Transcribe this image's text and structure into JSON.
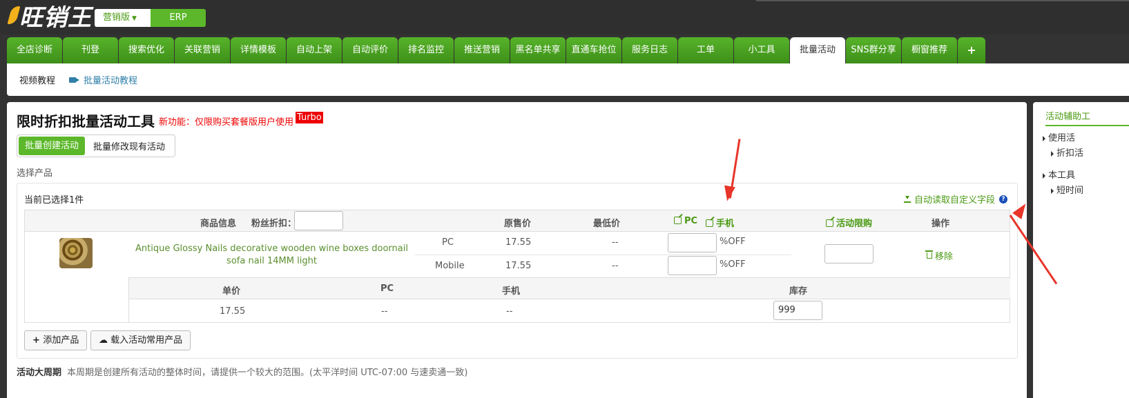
{
  "brand": {
    "logo_text": "旺销王",
    "version_label": "营销版",
    "erp_label": "ERP"
  },
  "tabs": [
    {
      "label": "全店诊断",
      "active": false
    },
    {
      "label": "刊登",
      "active": false
    },
    {
      "label": "搜索优化",
      "active": false
    },
    {
      "label": "关联营销",
      "active": false
    },
    {
      "label": "详情模板",
      "active": false
    },
    {
      "label": "自动上架",
      "active": false
    },
    {
      "label": "自动评价",
      "active": false
    },
    {
      "label": "排名监控",
      "active": false
    },
    {
      "label": "推送营销",
      "active": false
    },
    {
      "label": "黑名单共享",
      "active": false
    },
    {
      "label": "直通车抢位",
      "active": false
    },
    {
      "label": "服务日志",
      "active": false
    },
    {
      "label": "工单",
      "active": false
    },
    {
      "label": "小工具",
      "active": false
    },
    {
      "label": "批量活动",
      "active": true
    },
    {
      "label": "SNS群分享",
      "active": false
    },
    {
      "label": "橱窗推荐",
      "active": false
    },
    {
      "label": "+",
      "active": false
    }
  ],
  "subnav": {
    "video_label": "视频教程",
    "tutorial_link": "批量活动教程"
  },
  "main": {
    "title": "限时折扣批量活动工具",
    "new_feature": "新功能：仅限购买套餐版用户使用",
    "turbo": "Turbo",
    "btn_create": "批量创建活动",
    "btn_modify": "批量修改现有活动",
    "section_label": "选择产品",
    "selected_count": "当前已选择1件",
    "auto_read": "自动读取自定义字段",
    "help": "?",
    "headers": {
      "product_info": "商品信息",
      "fans_discount": "粉丝折扣：",
      "original_price": "原售价",
      "lowest_price": "最低价",
      "pc": "PC",
      "mobile": "手机",
      "limit": "活动限购",
      "action": "操作"
    },
    "product": {
      "name": "Antique Glossy Nails decorative wooden wine boxes doornail sofa nail 14MM light",
      "rows": [
        {
          "channel": "PC",
          "price": "17.55",
          "lowest": "--",
          "off": "%OFF"
        },
        {
          "channel": "Mobile",
          "price": "17.55",
          "lowest": "--",
          "off": "%OFF"
        }
      ],
      "remove": "移除"
    },
    "sku_headers": {
      "unit_price": "单价",
      "pc": "PC",
      "mobile": "手机",
      "stock": "库存"
    },
    "sku_row": {
      "unit_price": "17.55",
      "pc": "--",
      "mobile": "--",
      "stock": "999"
    },
    "add_product": "添加产品",
    "load_common": "载入活动常用产品",
    "period_label": "活动大周期",
    "period_desc": "本周期是创建所有活动的整体时间，请提供一个较大的范围。(太平洋时间 UTC-07:00 与速卖通一致)"
  },
  "side": {
    "title": "活动辅助工",
    "items": [
      "使用活",
      "折扣活",
      "本工具",
      "短时间"
    ]
  },
  "colors": {
    "accent": "#5cb82a",
    "brand_dark": "#2f2f2f",
    "alert": "#e8352a"
  }
}
